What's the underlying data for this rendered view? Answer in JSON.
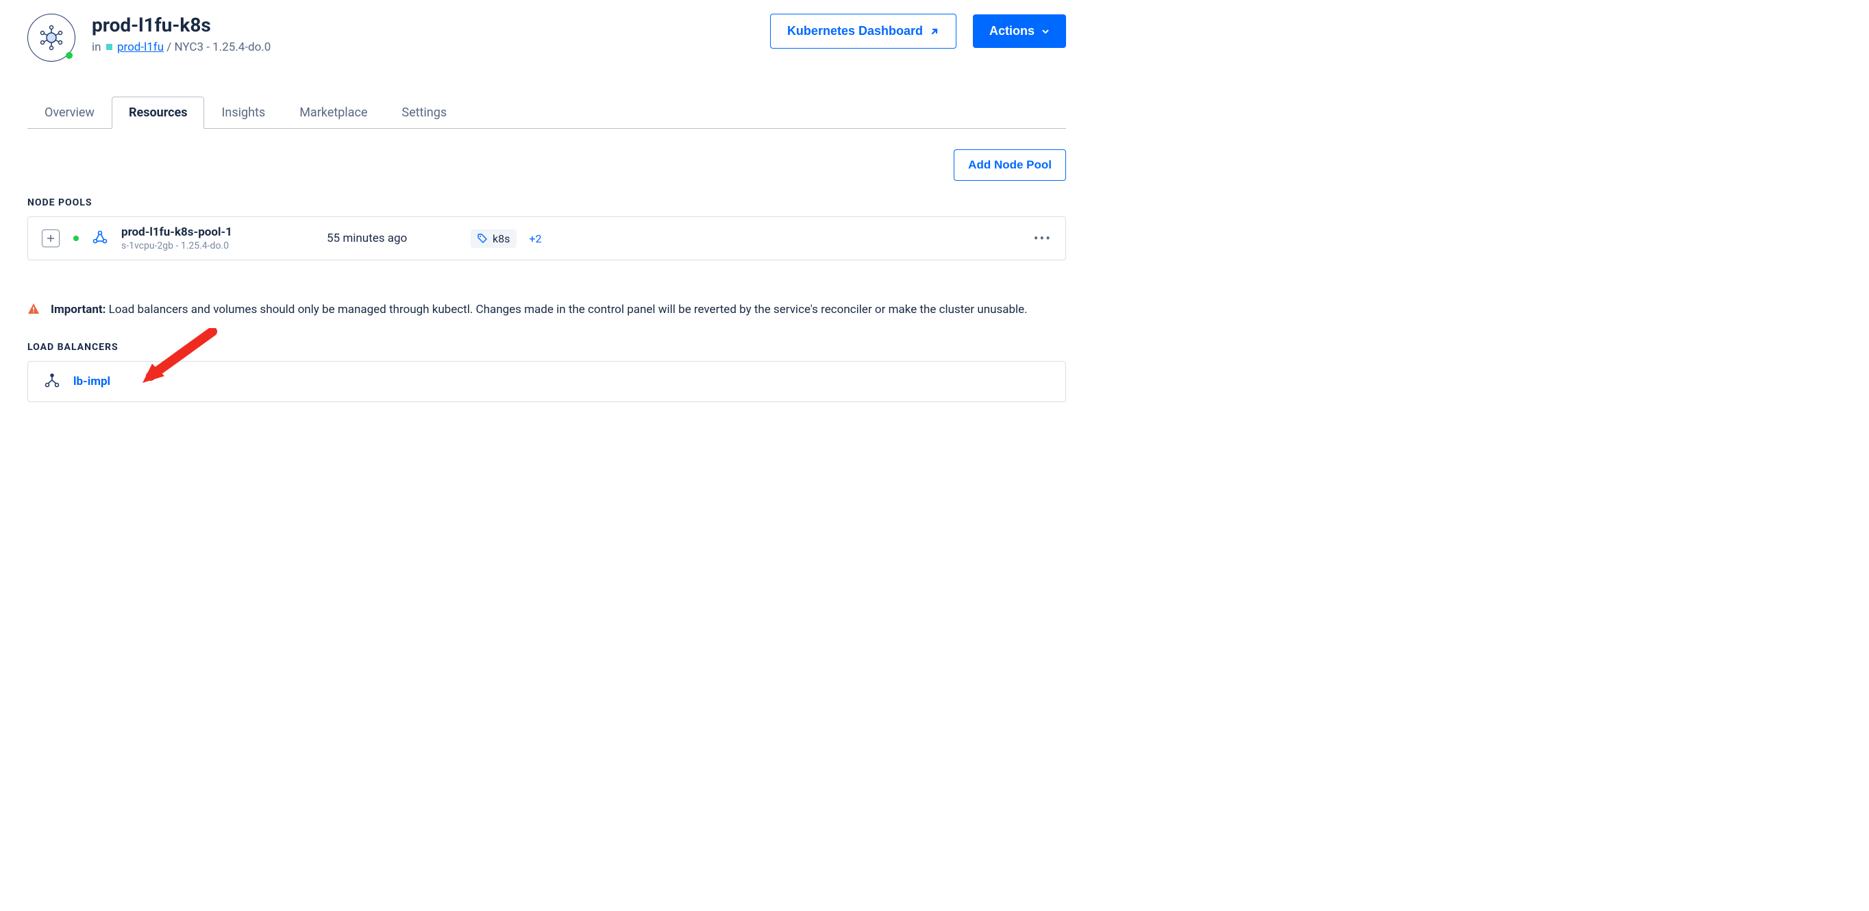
{
  "header": {
    "title": "prod-l1fu-k8s",
    "in_prefix": "in",
    "project": "prod-l1fu",
    "sep": "/",
    "region_version": "NYC3 - 1.25.4-do.0",
    "dashboard_btn": "Kubernetes Dashboard",
    "actions_btn": "Actions"
  },
  "tabs": [
    "Overview",
    "Resources",
    "Insights",
    "Marketplace",
    "Settings"
  ],
  "active_tab": 1,
  "add_node_pool_btn": "Add Node Pool",
  "sections": {
    "node_pools_label": "NODE POOLS",
    "load_balancers_label": "LOAD BALANCERS"
  },
  "node_pool": {
    "name": "prod-l1fu-k8s-pool-1",
    "subtitle": "s-1vcpu-2gb - 1.25.4-do.0",
    "created": "55 minutes ago",
    "tag": "k8s",
    "tag_more": "+2"
  },
  "alert": {
    "prefix": "Important:",
    "text": "Load balancers and volumes should only be managed through kubectl. Changes made in the control panel will be reverted by the service's reconciler or make the cluster unusable."
  },
  "load_balancer": {
    "name": "lb-impl"
  }
}
